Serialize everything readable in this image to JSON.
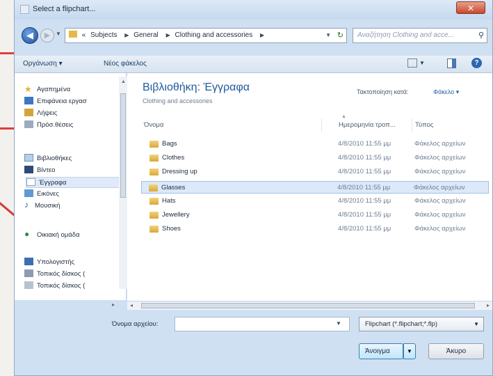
{
  "window": {
    "title": "Select a flipchart...",
    "close_label": "✕"
  },
  "address_bar": {
    "crumbs": [
      "«",
      "Subjects",
      "General",
      "Clothing and accessories"
    ],
    "search_placeholder": "Αναζήτηση Clothing and acce..."
  },
  "toolbar": {
    "organize": "Οργάνωση ▾",
    "new_folder": "Νέος φάκελος"
  },
  "nav": {
    "items": [
      {
        "label": "Αγαπημένα",
        "icon": "star-icon"
      },
      {
        "label": "Επιφάνεια εργασ",
        "icon": "desktop-icon"
      },
      {
        "label": "Λήψεις",
        "icon": "downloads-icon"
      },
      {
        "label": "Πρόσ.θέσεις",
        "icon": "recent-places-icon"
      },
      {
        "label": "Βιβλιοθήκες",
        "icon": "libraries-icon"
      },
      {
        "label": "Βίντεο",
        "icon": "video-icon"
      },
      {
        "label": "Έγγραφα",
        "icon": "documents-icon"
      },
      {
        "label": "Εικόνες",
        "icon": "pictures-icon"
      },
      {
        "label": "Μουσική",
        "icon": "music-icon"
      },
      {
        "label": "Οικιακή ομάδα",
        "icon": "homegroup-icon"
      },
      {
        "label": "Υπολογιστής",
        "icon": "computer-icon"
      },
      {
        "label": "Τοπικός δίσκος (",
        "icon": "local-disk-icon"
      },
      {
        "label": "Τοπικός δίσκος (",
        "icon": "local-disk-icon"
      }
    ]
  },
  "library": {
    "title": "Βιβλιοθήκη: Έγγραφα",
    "subtitle": "Clothing and accessories",
    "arrange_label": "Τακτοποίηση κατά:",
    "arrange_value": "Φάκελο ▾"
  },
  "columns": {
    "name": "Όνομα",
    "date": "Ημερομηνία τροπ...",
    "type": "Τύπος"
  },
  "files": [
    {
      "name": "Bags",
      "date": "4/8/2010 11:55 μμ",
      "type": "Φάκελος αρχείων"
    },
    {
      "name": "Clothes",
      "date": "4/8/2010 11:55 μμ",
      "type": "Φάκελος αρχείων"
    },
    {
      "name": "Dressing up",
      "date": "4/8/2010 11:55 μμ",
      "type": "Φάκελος αρχείων"
    },
    {
      "name": "Glasses",
      "date": "4/8/2010 11:55 μμ",
      "type": "Φάκελος αρχείων"
    },
    {
      "name": "Hats",
      "date": "4/8/2010 11:55 μμ",
      "type": "Φάκελος αρχείων"
    },
    {
      "name": "Jewellery",
      "date": "4/8/2010 11:55 μμ",
      "type": "Φάκελος αρχείων"
    },
    {
      "name": "Shoes",
      "date": "4/8/2010 11:55 μμ",
      "type": "Φάκελος αρχείων"
    }
  ],
  "footer": {
    "filename_label": "Όνομα αρχείου:",
    "filename_value": "",
    "filetype": "Flipchart (*.flipchart;*.flp)",
    "open_label": "Άνοιγμα",
    "cancel_label": "Άκυρο"
  },
  "colors": {
    "annotation": "#e23b3b",
    "accent": "#1e5b9c",
    "selection": "#dce9f9"
  }
}
